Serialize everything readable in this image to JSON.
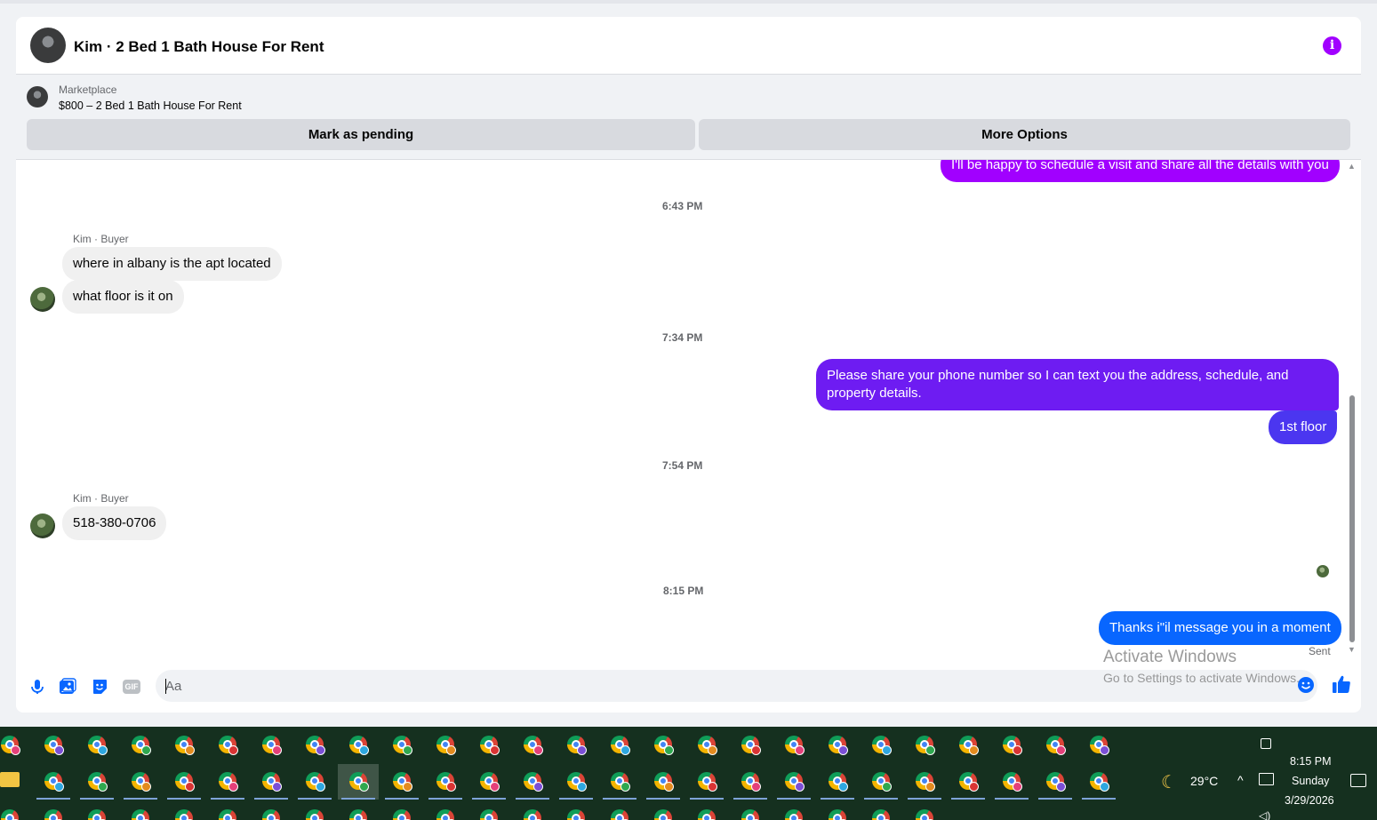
{
  "header": {
    "title": "Kim · 2 Bed 1 Bath House For Rent",
    "info_icon": "i"
  },
  "listing": {
    "label": "Marketplace",
    "title": "$800 – 2 Bed 1 Bath House For Rent",
    "mark_pending_label": "Mark as pending",
    "more_options_label": "More Options"
  },
  "messages": {
    "first_out": "I'll be happy to schedule a visit and share all the details with you",
    "time_1": "6:43 PM",
    "sender_1": "Kim · Buyer",
    "in_1": "where in albany is the apt located",
    "in_2": "what floor is it on",
    "time_2": "7:34 PM",
    "out_1_line1": "Please share your phone number so I can text you the address, schedule, and",
    "out_1_line2": "property details.",
    "out_2": "1st floor",
    "time_3": "7:54 PM",
    "sender_2": "Kim · Buyer",
    "in_3": "518-380-0706",
    "time_4": "8:15 PM",
    "out_3": "Thanks i\"il message you in a moment",
    "status": "Sent"
  },
  "colors": {
    "bubble_magenta": "#a100ff",
    "bubble_violet": "#6e1cf2",
    "bubble_indigo": "#4b36f0",
    "bubble_blue": "#0866ff",
    "accent": "#0866ff"
  },
  "composer": {
    "placeholder": "Aa",
    "icons": [
      "microphone-icon",
      "image-icon",
      "sticker-icon",
      "gif-icon",
      "emoji-icon",
      "thumbs-up-icon"
    ],
    "gif_label": "GIF"
  },
  "watermark": {
    "line1": "Activate Windows",
    "line2": "Go to Settings to activate Windows."
  },
  "taskbar": {
    "weather_icon": "moon-icon",
    "temperature": "29°C",
    "time": "8:15 PM",
    "day": "Sunday",
    "date": "3/29/2026"
  }
}
